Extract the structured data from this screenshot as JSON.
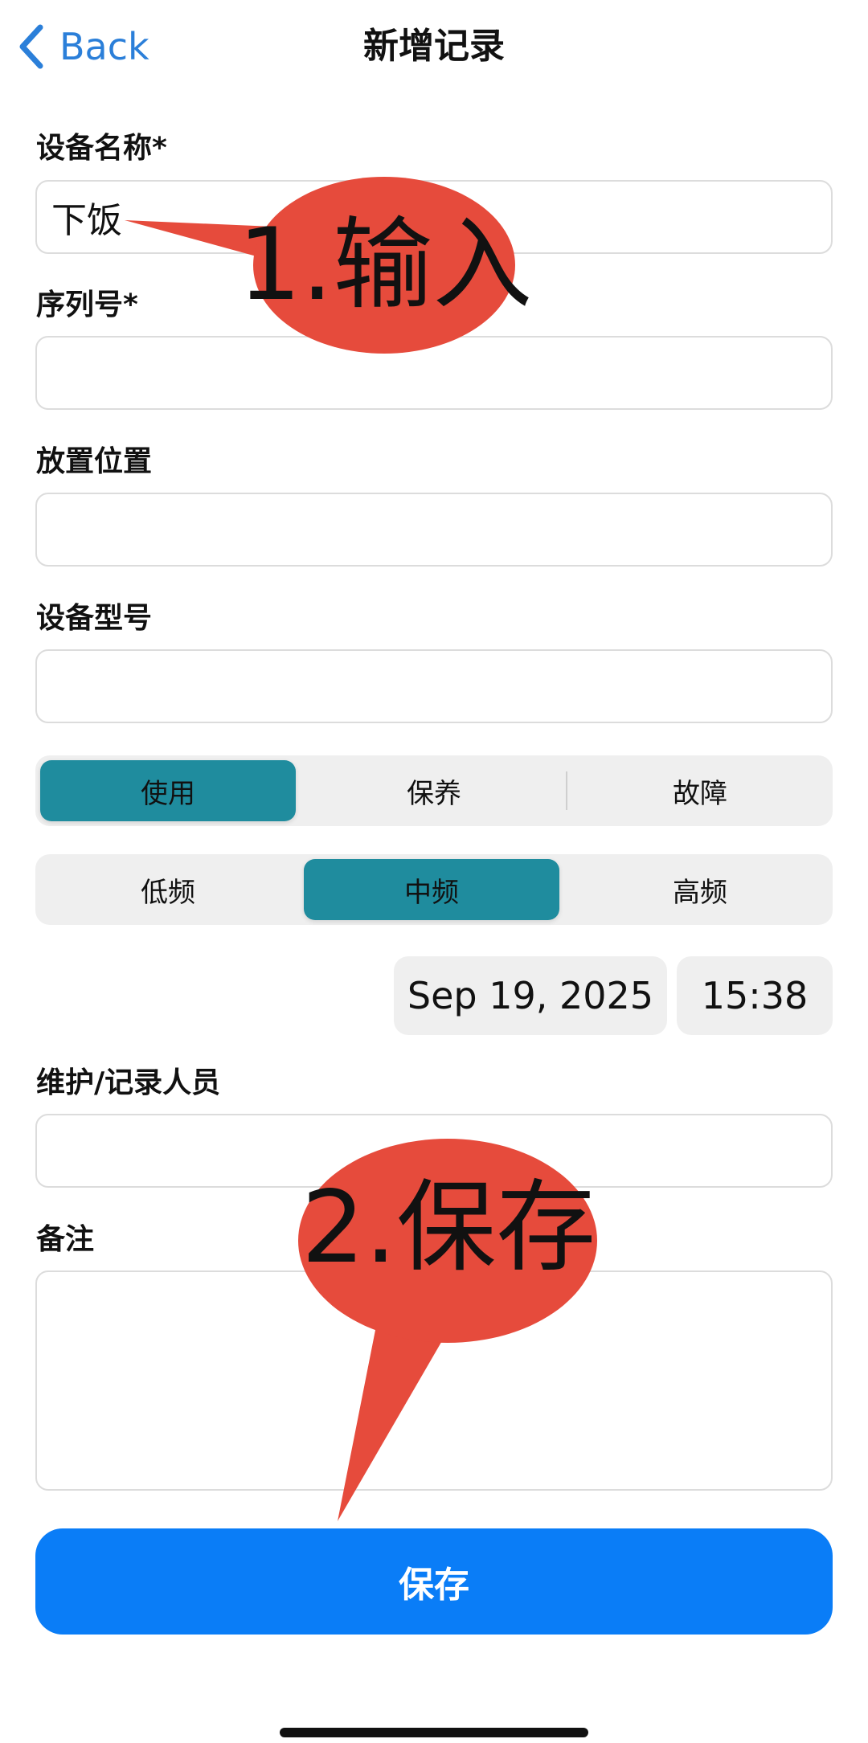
{
  "nav": {
    "back_label": "Back",
    "title": "新增记录"
  },
  "form": {
    "device_name": {
      "label": "设备名称*",
      "value": "下饭"
    },
    "serial_no": {
      "label": "序列号*",
      "value": ""
    },
    "location": {
      "label": "放置位置",
      "value": ""
    },
    "model": {
      "label": "设备型号",
      "value": ""
    },
    "status_segment": {
      "options": [
        "使用",
        "保养",
        "故障"
      ],
      "selected": "使用"
    },
    "frequency_segment": {
      "options": [
        "低频",
        "中频",
        "高频"
      ],
      "selected": "中频"
    },
    "date": "Sep 19, 2025",
    "time": "15:38",
    "maintainer": {
      "label": "维护/记录人员",
      "value": ""
    },
    "notes": {
      "label": "备注",
      "value": ""
    },
    "save_label": "保存"
  },
  "annotations": {
    "step1": "1.输入",
    "step2": "2.保存",
    "color": "#e64b3c"
  },
  "colors": {
    "accent_blue": "#0a7df7",
    "back_blue": "#2b7fd9",
    "segment_active": "#1f8c9e"
  }
}
